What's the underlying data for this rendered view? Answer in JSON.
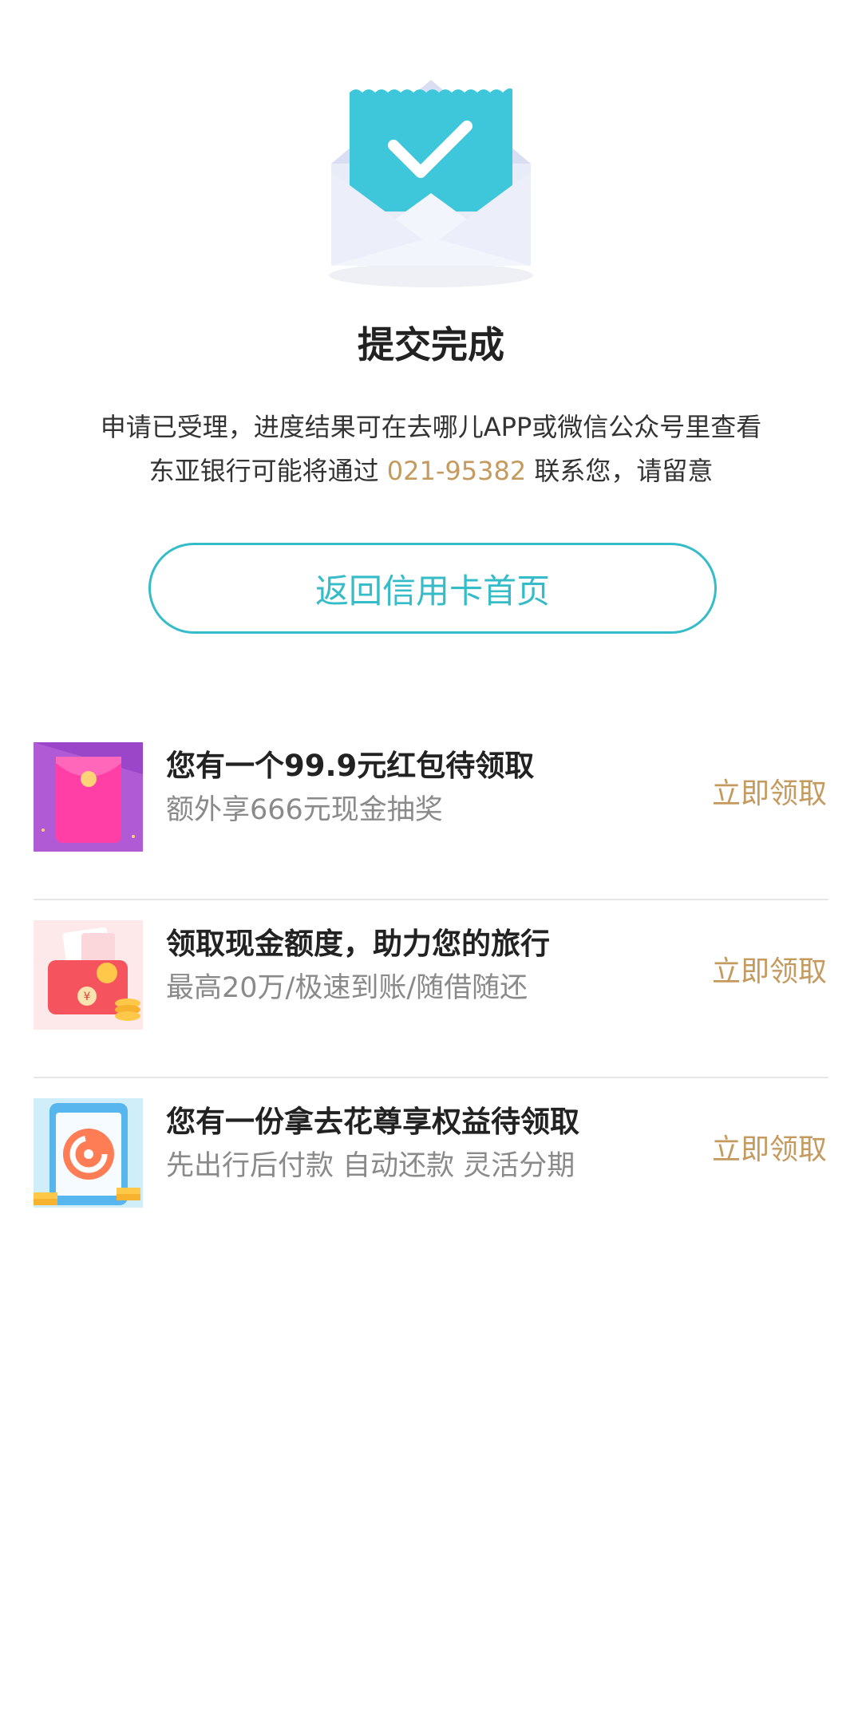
{
  "result": {
    "title": "提交完成",
    "line1": "申请已受理，进度结果可在去哪儿APP或微信公众号里查看",
    "line2_prefix": "东亚银行可能将通过 ",
    "phone": "021-95382",
    "line2_suffix": " 联系您，请留意",
    "home_button": "返回信用卡首页"
  },
  "offers": [
    {
      "title": "您有一个99.9元红包待领取",
      "subtitle": "额外享666元现金抽奖",
      "cta": "立即领取",
      "icon": "red-envelope-icon"
    },
    {
      "title": "领取现金额度，助力您的旅行",
      "subtitle": "最高20万/极速到账/随借随还",
      "cta": "立即领取",
      "icon": "cash-wallet-icon"
    },
    {
      "title": "您有一份拿去花尊享权益待领取",
      "subtitle": "先出行后付款 自动还款 灵活分期",
      "cta": "立即领取",
      "icon": "phone-payment-icon"
    }
  ],
  "colors": {
    "accent": "#35bcc8",
    "gold": "#c49a5e"
  }
}
